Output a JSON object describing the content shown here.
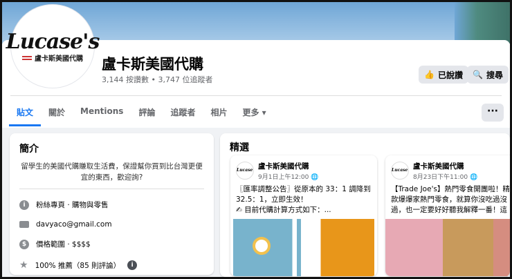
{
  "page": {
    "logo_text": "Lucase's",
    "logo_sub": "盧卡斯美國代購",
    "name": "盧卡斯美國代購",
    "stats": "3,144 按讚數 • 3,747 位追蹤者"
  },
  "actions": {
    "liked": "已說讚",
    "search": "搜尋",
    "more": "···"
  },
  "tabs": [
    "貼文",
    "關於",
    "Mentions",
    "評論",
    "追蹤者",
    "相片",
    "更多 ▾"
  ],
  "intro": {
    "title": "簡介",
    "bio": "留學生的美國代購賺取生活費，保證幫你買到比台灣更便宜的東西，歡迎詢?",
    "category": "粉絲專頁 · 購物與零售",
    "email": "davyaco@gmail.com",
    "price": "價格範圍 · $$$$",
    "rating": "100% 推薦（85 則評論）"
  },
  "featured": {
    "title": "精選",
    "posts": [
      {
        "author": "盧卡斯美國代購",
        "date": "9月1日上午12:00 🌐",
        "lines": [
          "〖匯率調整公告〗從原本的 33：1 調降到",
          "32.5：1，立即生效！",
          "✍ 目前代購計算方式如下：..."
        ]
      },
      {
        "author": "盧卡斯美國代購",
        "date": "8月23日下午11:00 🌐",
        "lines": [
          "【Trade Joe's】熱門零食開團啦！精",
          "款爆爆家熱門零食，就算你沒吃過沒",
          "過，也一定要好好聽我解釋一番！這"
        ]
      }
    ]
  }
}
